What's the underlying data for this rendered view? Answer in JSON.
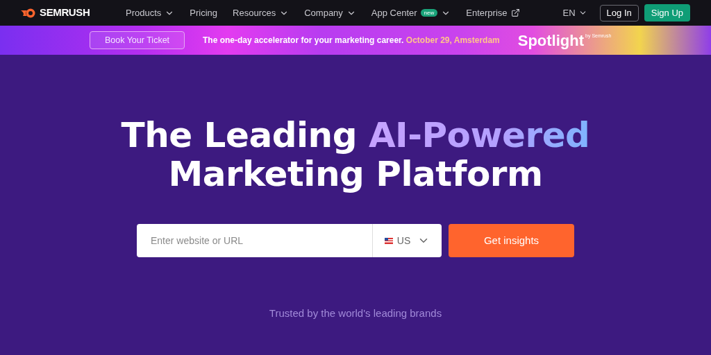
{
  "nav": {
    "logo": "SEMRUSH",
    "items": [
      {
        "label": "Products",
        "kind": "dropdown"
      },
      {
        "label": "Pricing",
        "kind": "link"
      },
      {
        "label": "Resources",
        "kind": "dropdown"
      },
      {
        "label": "Company",
        "kind": "dropdown"
      },
      {
        "label": "App Center",
        "kind": "dropdown",
        "badge": "new"
      },
      {
        "label": "Enterprise",
        "kind": "external"
      }
    ],
    "language": "EN",
    "login": "Log In",
    "signup": "Sign Up"
  },
  "banner": {
    "button": "Book Your Ticket",
    "text": "The one-day accelerator for your marketing career.",
    "highlight": "October 29, Amsterdam",
    "brand": "Spotlight",
    "brand_sub": "by Semrush"
  },
  "hero": {
    "title_start": "The Leading",
    "title_highlight": "AI-Powered",
    "title_end": "Marketing Platform",
    "search": {
      "placeholder": "Enter website or URL",
      "country": "US",
      "button": "Get insights"
    },
    "trusted": "Trusted by the world's leading brands"
  }
}
